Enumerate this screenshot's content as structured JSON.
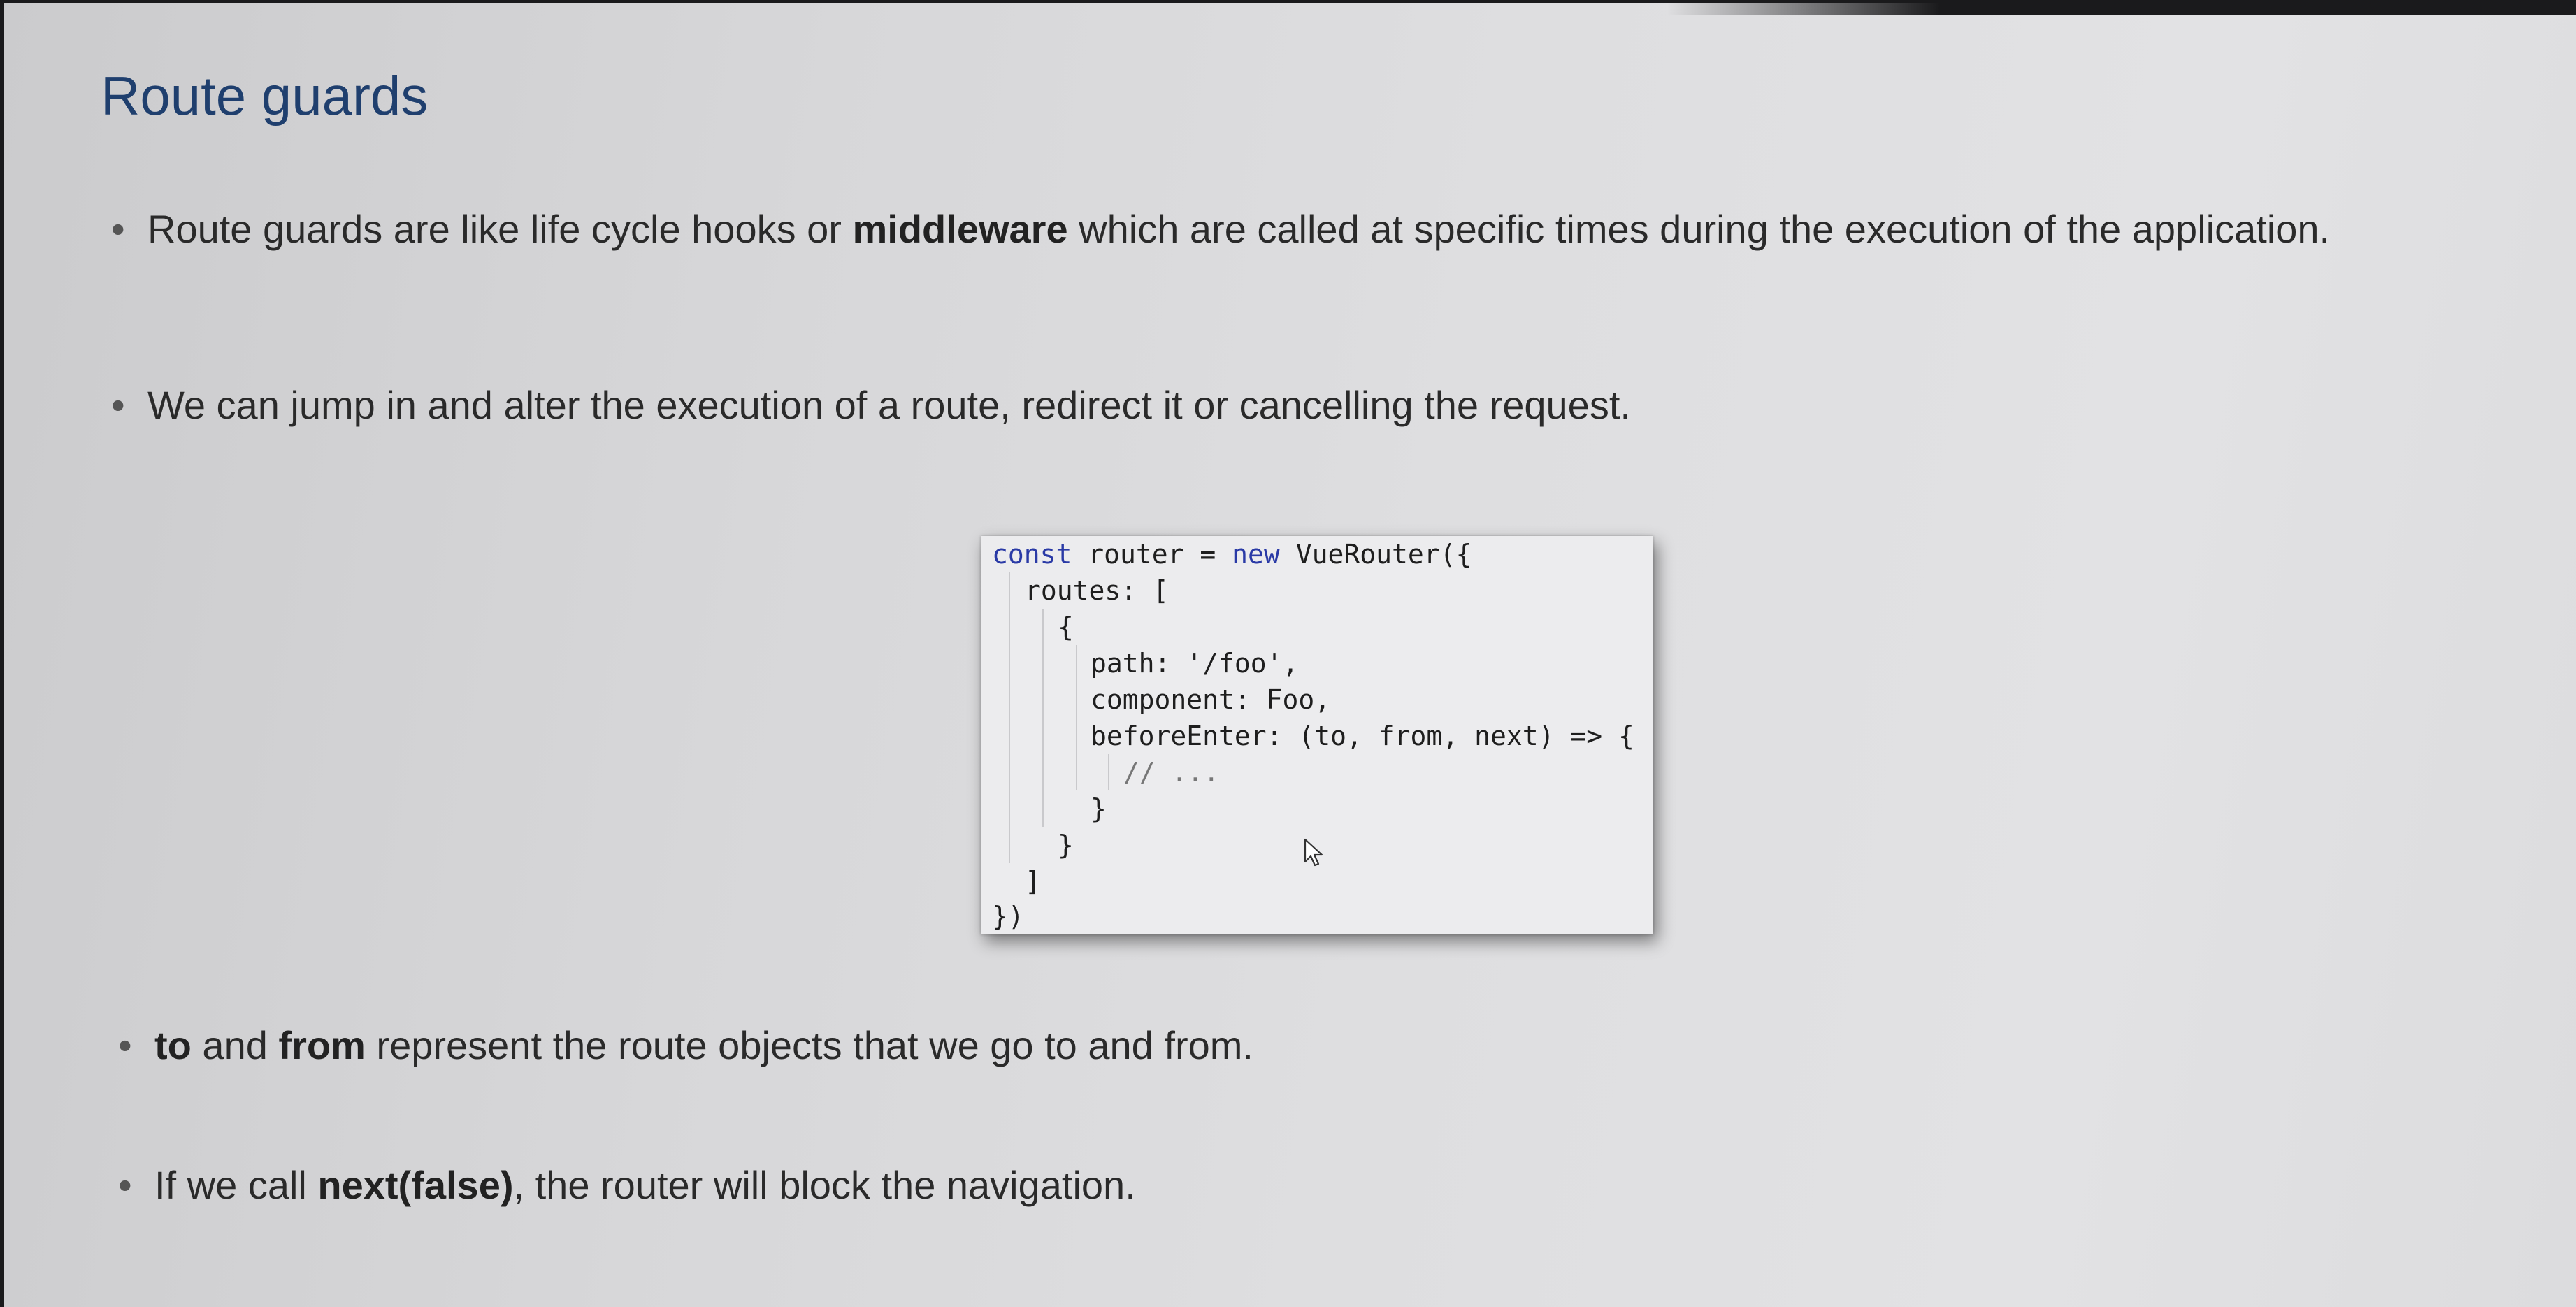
{
  "slide": {
    "title": "Route guards",
    "bullets": [
      {
        "parts": [
          "Route guards are like life cycle hooks or ",
          "middleware",
          " which are called at specific times during the execution of the application."
        ]
      },
      {
        "parts": [
          "We can jump in and alter the execution of a route, redirect it or cancelling the request."
        ]
      },
      {
        "parts": [
          "to",
          " and ",
          "from",
          " represent the route objects that we go to and from."
        ]
      },
      {
        "parts": [
          "If we call ",
          "next(false)",
          ", the router will block the navigation."
        ]
      }
    ],
    "bullet_glyph": "•"
  },
  "code": {
    "line0_kw1": "const",
    "line0_mid": " router = ",
    "line0_kw2": "new",
    "line0_end": " VueRouter({",
    "line1": "routes: [",
    "line2": "{",
    "line3": "path: '/foo',",
    "line4": "component: Foo,",
    "line5": "beforeEnter: (to, from, next) => {",
    "line6": "// ...",
    "line7": "}",
    "line8": "}",
    "line9": "]",
    "line10": "})"
  },
  "colors": {
    "title": "#1f3f6e",
    "keyword": "#2a3aa6",
    "text": "#2a2a2a"
  },
  "icons": {
    "cursor": "mouse-pointer-icon"
  }
}
